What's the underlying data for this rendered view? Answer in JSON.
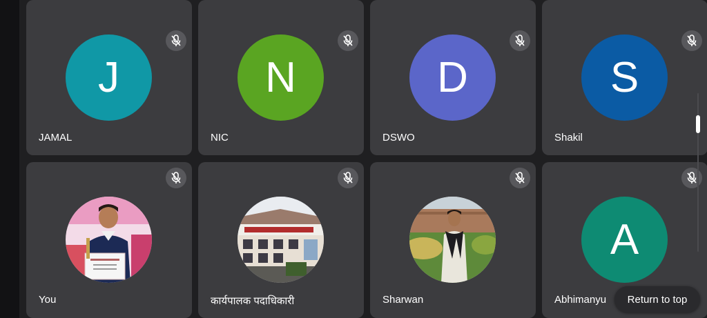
{
  "participants": [
    {
      "name": "JAMAL",
      "initial": "J",
      "avatar_color": "#1098a6",
      "muted": true
    },
    {
      "name": "NIC",
      "initial": "N",
      "avatar_color": "#5aa522",
      "muted": true
    },
    {
      "name": "DSWO",
      "initial": "D",
      "avatar_color": "#5b66c9",
      "muted": true
    },
    {
      "name": "Shakil",
      "initial": "S",
      "avatar_color": "#0b5ba4",
      "muted": true
    },
    {
      "name": "You",
      "initial": "",
      "avatar_color": "#e37bb0",
      "muted": true
    },
    {
      "name": "कार्यपालक पदाधिकारी",
      "initial": "",
      "avatar_color": "#8d8b88",
      "muted": true
    },
    {
      "name": "Sharwan",
      "initial": "",
      "avatar_color": "#8e7a55",
      "muted": true
    },
    {
      "name": "Abhimanyu",
      "initial": "A",
      "avatar_color": "#0e8b73",
      "muted": true
    }
  ],
  "icons": {
    "mute": "mic-off-icon"
  },
  "return_to_top": "Return to top",
  "colors": {
    "background": "#1f1f21",
    "tile": "#3c3c3f",
    "mute_badge": "#58585c"
  }
}
